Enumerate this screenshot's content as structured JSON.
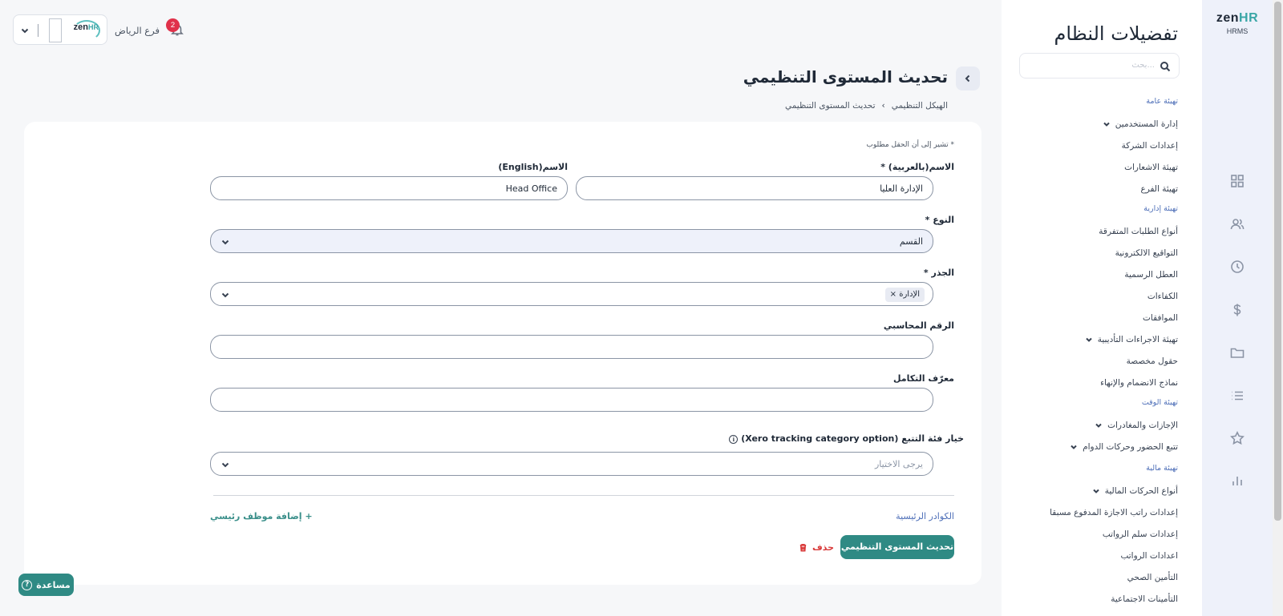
{
  "brand": {
    "zen": "zen",
    "hr": "HR",
    "subtitle": "HRMS"
  },
  "rail_icons": [
    "dashboard-icon",
    "people-icon",
    "clock-icon",
    "dollar-icon",
    "folder-icon",
    "list-icon",
    "star-icon",
    "chart-icon"
  ],
  "settings": {
    "title": "تفضيلات النظام",
    "search_placeholder": "بحث...",
    "groups": [
      {
        "label": "تهيئة عامة"
      },
      {
        "label": "تهيئة إدارية"
      },
      {
        "label": "تهيئة الوقت"
      },
      {
        "label": "تهيئة مالية"
      }
    ],
    "items": [
      {
        "label": "إدارة المستخدمين",
        "expandable": true
      },
      {
        "label": "إعدادات الشركة",
        "expandable": false
      },
      {
        "label": "تهيئة الاشعارات",
        "expandable": false
      },
      {
        "label": "تهيئة الفرع",
        "expandable": false
      },
      {
        "label": "أنواع الطلبات المتفرقة",
        "expandable": false
      },
      {
        "label": "التواقيع الالكترونية",
        "expandable": false
      },
      {
        "label": "العطل الرسمية",
        "expandable": false
      },
      {
        "label": "الكفاءات",
        "expandable": false
      },
      {
        "label": "الموافقات",
        "expandable": false
      },
      {
        "label": "تهيئة الاجراءات التأديبية",
        "expandable": true
      },
      {
        "label": "حقول مخصصة",
        "expandable": false
      },
      {
        "label": "نماذج الانضمام والإنهاء",
        "expandable": false
      },
      {
        "label": "الإجازات والمغادرات",
        "expandable": true
      },
      {
        "label": "تتبع الحضور وحركات الدوام",
        "expandable": true
      },
      {
        "label": "أنواع الحركات المالية",
        "expandable": true
      },
      {
        "label": "إعدادات راتب الاجازة المدفوع مسبقا",
        "expandable": false
      },
      {
        "label": "إعدادات سلم الرواتب",
        "expandable": false
      },
      {
        "label": "اعدادات الرواتب",
        "expandable": false
      },
      {
        "label": "التأمين الصحي",
        "expandable": false
      },
      {
        "label": "التأمينات الاجتماعية",
        "expandable": false
      }
    ]
  },
  "topbar": {
    "branch_name": "فرع الرياض",
    "notifications_count": "2",
    "company_logo": {
      "zen": "zen",
      "hr": "HR"
    }
  },
  "page": {
    "title": "تحديث المستوى التنظيمي",
    "breadcrumb": [
      "الهيكل التنظيمي",
      "تحديث المستوى التنظيمي"
    ],
    "breadcrumb_sep": "›"
  },
  "form": {
    "required_note": "* تشير إلى أن الحقل مطلوب",
    "name_ar": {
      "label": "الاسم(بالعربية)",
      "required": "*",
      "value": "الإدارة العليا"
    },
    "name_en": {
      "label": "الاسم(English)",
      "value": "Head Office"
    },
    "type": {
      "label": "النوع",
      "required": "*",
      "value": "القسم"
    },
    "root": {
      "label": "الجذر",
      "required": "*",
      "tag": "الإدارة",
      "tag_remove": "×"
    },
    "account_number": {
      "label": "الرقم المحاسبي",
      "value": ""
    },
    "integration_id": {
      "label": "معرّف التكامل",
      "value": ""
    },
    "xero": {
      "label": "خيار فئة التتبع (Xero tracking category option)",
      "info": "i",
      "placeholder": "يرجى الاختيار"
    },
    "key_staff_label": "الكوادر الرئيسية",
    "add_key_staff": "+ إضافة موظف رئيسي",
    "submit_label": "تحديث المستوى التنظيمي",
    "delete_label": "حذف"
  },
  "help": {
    "label": "مساعدة",
    "icon": "?"
  }
}
